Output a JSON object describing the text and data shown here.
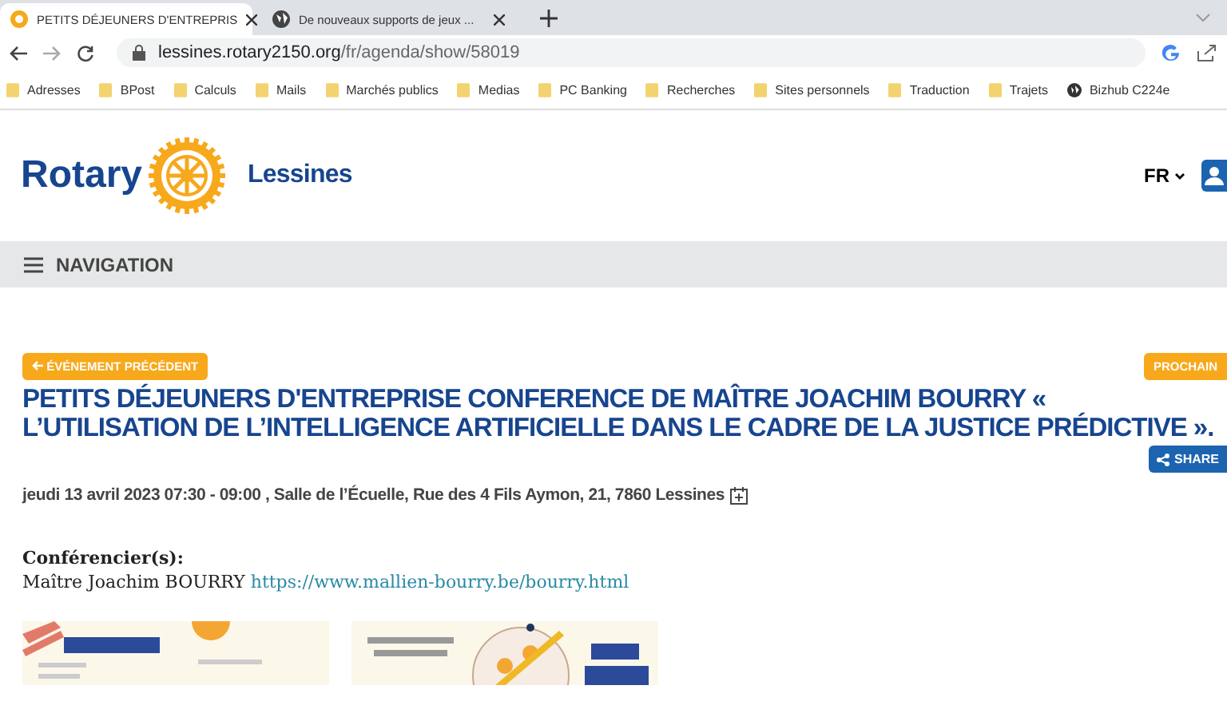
{
  "tabs": [
    {
      "title": "PETITS DÉJEUNERS D'ENTREPRIS",
      "selected": true
    },
    {
      "title": "De nouveaux supports de jeux ...",
      "selected": false
    }
  ],
  "address": {
    "url_host": "lessines.rotary2150.org",
    "url_path": "/fr/agenda/show/58019"
  },
  "bookmarks": [
    {
      "label": "Adresses",
      "kind": "folder"
    },
    {
      "label": "BPost",
      "kind": "folder"
    },
    {
      "label": "Calculs",
      "kind": "folder"
    },
    {
      "label": "Mails",
      "kind": "folder"
    },
    {
      "label": "Marchés publics",
      "kind": "folder"
    },
    {
      "label": "Medias",
      "kind": "folder"
    },
    {
      "label": "PC Banking",
      "kind": "folder"
    },
    {
      "label": "Recherches",
      "kind": "folder"
    },
    {
      "label": "Sites personnels",
      "kind": "folder"
    },
    {
      "label": "Traduction",
      "kind": "folder"
    },
    {
      "label": "Trajets",
      "kind": "folder"
    },
    {
      "label": "Bizhub C224e",
      "kind": "site"
    }
  ],
  "header": {
    "brand": "Rotary",
    "club": "Lessines",
    "language": "FR"
  },
  "navigation": {
    "label": "NAVIGATION"
  },
  "event": {
    "prev_button": "ÉVÉNEMENT PRÉCÉDENT",
    "next_button": "PROCHAIN",
    "title": "PETITS DÉJEUNERS D'ENTREPRISE CONFERENCE DE MAÎTRE JOACHIM BOURRY « L’UTILISATION DE L’INTELLIGENCE ARTIFICIELLE DANS LE CADRE DE LA JUSTICE PRÉDICTIVE ».",
    "share_button": "SHARE",
    "details": "jeudi 13 avril 2023 07:30 - 09:00 , Salle de l’Écuelle, Rue des 4 Fils Aymon, 21, 7860 Lessines",
    "speakers_label": "Conférencier(s):",
    "speaker": "Maître Joachim BOURRY",
    "speaker_link": "https://www.mallien-bourry.be/bourry.html"
  }
}
